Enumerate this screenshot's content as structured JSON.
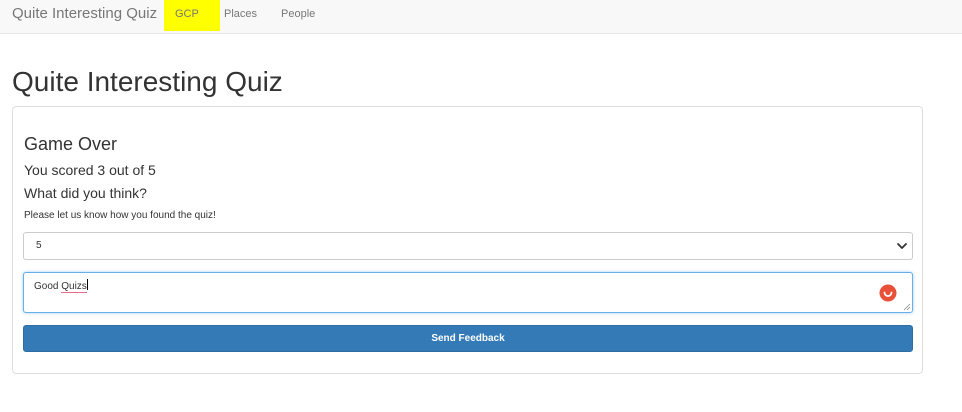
{
  "navbar": {
    "brand": "Quite Interesting Quiz",
    "links": [
      "GCP",
      "Places",
      "People"
    ]
  },
  "page": {
    "title": "Quite Interesting Quiz"
  },
  "panel": {
    "heading": "Game Over",
    "score_text": "You scored 3 out of 5",
    "question": "What did you think?",
    "hint": "Please let us know how you found the quiz!",
    "rating_select": {
      "selected": "5"
    },
    "feedback_textarea": {
      "value_first": "Good",
      "value_second": "Quizs"
    },
    "send_button": "Send Feedback"
  },
  "colors": {
    "highlight": "#ffff00",
    "primary": "#337ab7",
    "focus_border": "#66afe9",
    "grammar_icon": "#e8503a"
  },
  "icons": [
    "chevron-down-icon",
    "grammar-check-icon",
    "resize-handle-icon"
  ]
}
